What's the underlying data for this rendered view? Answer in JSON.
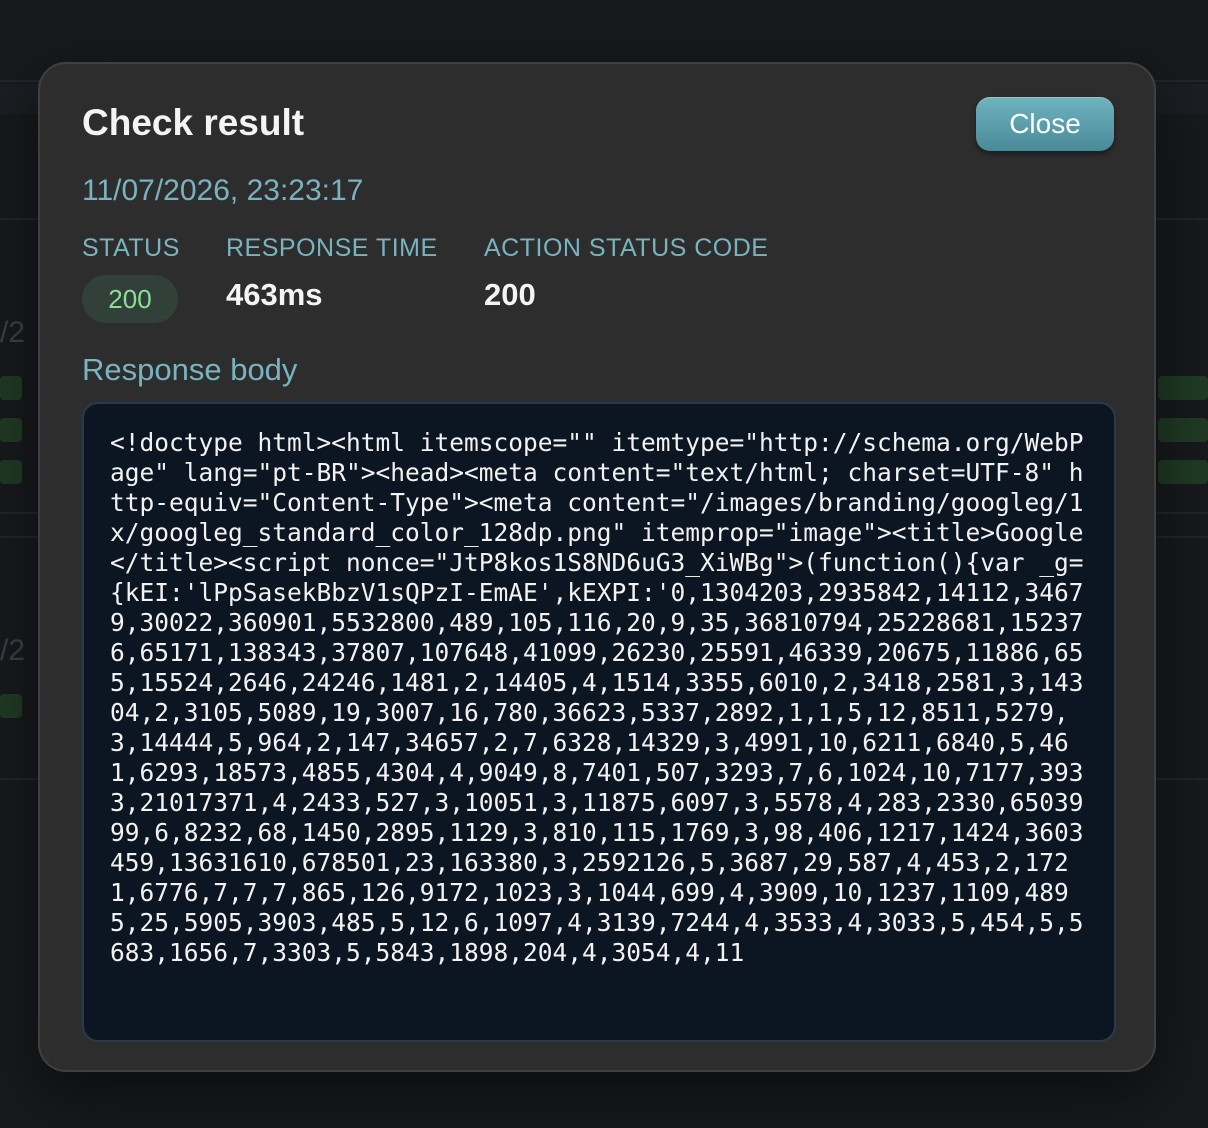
{
  "background": {
    "fractions": [
      "/2",
      "/2"
    ]
  },
  "modal": {
    "title": "Check result",
    "close_label": "Close",
    "timestamp": "11/07/2026, 23:23:17",
    "stats": {
      "status_label": "STATUS",
      "status_value": "200",
      "response_time_label": "RESPONSE TIME",
      "response_time_value": "463ms",
      "action_status_label": "ACTION STATUS CODE",
      "action_status_value": "200"
    },
    "response_body_label": "Response body",
    "response_body": "<!doctype html><html itemscope=\"\" itemtype=\"http://schema.org/WebPage\" lang=\"pt-BR\"><head><meta content=\"text/html; charset=UTF-8\" http-equiv=\"Content-Type\"><meta content=\"/images/branding/googleg/1x/googleg_standard_color_128dp.png\" itemprop=\"image\"><title>Google</title><script nonce=\"JtP8kos1S8ND6uG3_XiWBg\">(function(){var _g={kEI:'lPpSasekBbzV1sQPzI-EmAE',kEXPI:'0,1304203,2935842,14112,34679,30022,360901,5532800,489,105,116,20,9,35,36810794,25228681,152376,65171,138343,37807,107648,41099,26230,25591,46339,20675,11886,655,15524,2646,24246,1481,2,14405,4,1514,3355,6010,2,3418,2581,3,14304,2,3105,5089,19,3007,16,780,36623,5337,2892,1,1,5,12,8511,5279,3,14444,5,964,2,147,34657,2,7,6328,14329,3,4991,10,6211,6840,5,461,6293,18573,4855,4304,4,9049,8,7401,507,3293,7,6,1024,10,7177,3933,21017371,4,2433,527,3,10051,3,11875,6097,3,5578,4,283,2330,6503999,6,8232,68,1450,2895,1129,3,810,115,1769,3,98,406,1217,1424,3603459,13631610,678501,23,163380,3,2592126,5,3687,29,587,4,453,2,1721,6776,7,7,7,865,126,9172,1023,3,1044,699,4,3909,10,1237,1109,4895,25,5905,3903,485,5,12,6,1097,4,3139,7244,4,3533,4,3033,5,454,5,5683,1656,7,3303,5,5843,1898,204,4,3054,4,11"
  }
}
